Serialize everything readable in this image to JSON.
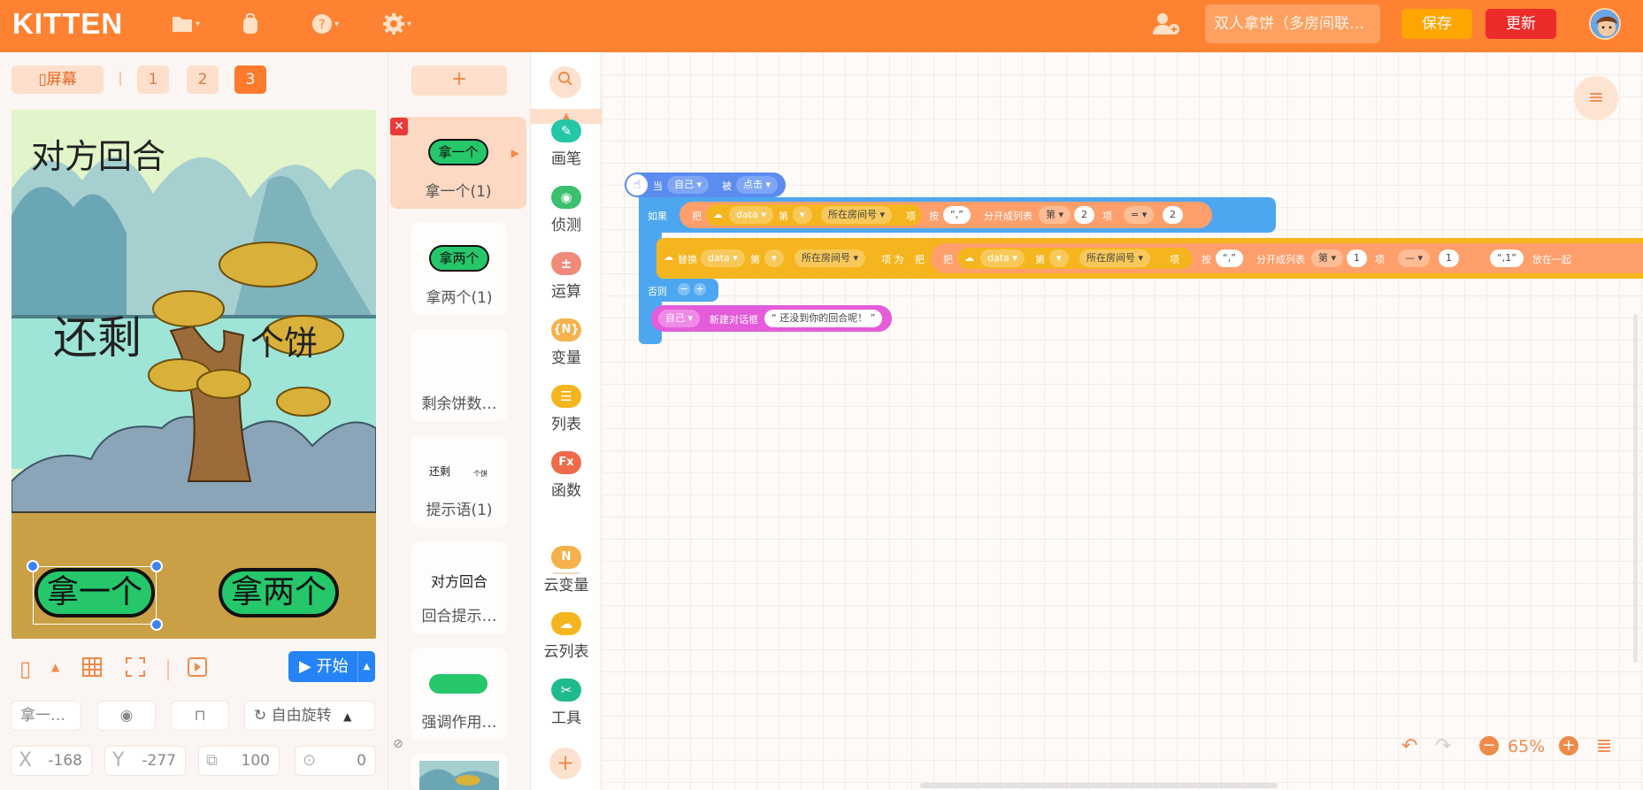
{
  "header": {
    "logo": "KITTEN",
    "project_name": "双人拿饼（多房间联…",
    "save_label": "保存",
    "update_label": "更新",
    "colors": {
      "bar": "#fe8232",
      "save": "#ffa500",
      "update": "#ec2b2b"
    }
  },
  "stage_panel": {
    "screen_label": "屏幕",
    "screens": [
      "1",
      "2",
      "3"
    ],
    "active_screen": "3",
    "stage_texts": {
      "turn": "对方回合",
      "remaining": "还剩",
      "cakes": "个饼"
    },
    "buttons": {
      "take_one": "拿一个",
      "take_two": "拿两个"
    },
    "start_label": "开始",
    "sprite_name": "拿一…",
    "rotate_label": "自由旋转",
    "x_label": "X",
    "x_value": "-168",
    "y_label": "Y",
    "y_value": "-277",
    "size_value": "100",
    "rotation_value": "0"
  },
  "sprites": {
    "add_label": "+",
    "items": [
      {
        "thumb": "拿一个",
        "name": "拿一个(1)"
      },
      {
        "thumb": "拿两个",
        "name": "拿两个(1)"
      },
      {
        "thumb": "",
        "name": "剩余饼数…"
      },
      {
        "thumb": "还剩",
        "thumb2": "个饼",
        "name": "提示语(1)"
      },
      {
        "thumb": "对方回合",
        "name": "回合提示…"
      },
      {
        "thumb": "",
        "name": "强调作用…"
      }
    ]
  },
  "categories": {
    "items": [
      {
        "label": "画笔",
        "icon": "pen-icon",
        "color": "#24c6a6"
      },
      {
        "label": "侦测",
        "icon": "detect-icon",
        "color": "#3cbf6e"
      },
      {
        "label": "运算",
        "icon": "math-icon",
        "color": "#f08a7a"
      },
      {
        "label": "变量",
        "icon": "variable-icon",
        "color": "#f5b24c",
        "glyph": "{N}"
      },
      {
        "label": "列表",
        "icon": "list-icon",
        "color": "#f5b51e"
      },
      {
        "label": "函数",
        "icon": "function-icon",
        "color": "#ee6a4a",
        "glyph": "Fx"
      },
      {
        "label": "云变量",
        "icon": "cloud-variable-icon",
        "color": "#f5b24c",
        "glyph": "N"
      },
      {
        "label": "云列表",
        "icon": "cloud-list-icon",
        "color": "#f5b51e"
      },
      {
        "label": "工具",
        "icon": "tools-icon",
        "color": "#1fb98e"
      }
    ]
  },
  "code": {
    "event": {
      "when": "当",
      "target": "自己",
      "clicked": "被",
      "action": "点击"
    },
    "if_label": "如果",
    "else_label": "否则",
    "row1": {
      "ba": "把",
      "data": "data",
      "di": "第",
      "room": "所在房间号",
      "xiang": "项",
      "an": "按",
      "comma": "“,”",
      "split": "分开成列表",
      "di2": "第",
      "num": "2",
      "xiang2": "项",
      "eq": "=",
      "val": "2"
    },
    "row2": {
      "replace": "替换",
      "data": "data",
      "di": "第",
      "room": "所在房间号",
      "xiang_wei": "项 为",
      "ba": "把",
      "ba2": "把",
      "data2": "data",
      "di2": "第",
      "room2": "所在房间号",
      "xiang": "项",
      "an": "按",
      "comma": "“,”",
      "split": "分开成列表",
      "di3": "第",
      "num": "1",
      "xiang2": "项",
      "minus": "—",
      "val": "1",
      "str": "“,1”",
      "join": "放在一起"
    },
    "row3": {
      "self": "自己",
      "dialog": "新建对话框",
      "text": "“ 还没到你的回合呢！ ”"
    }
  },
  "workspace": {
    "zoom": "65%"
  }
}
